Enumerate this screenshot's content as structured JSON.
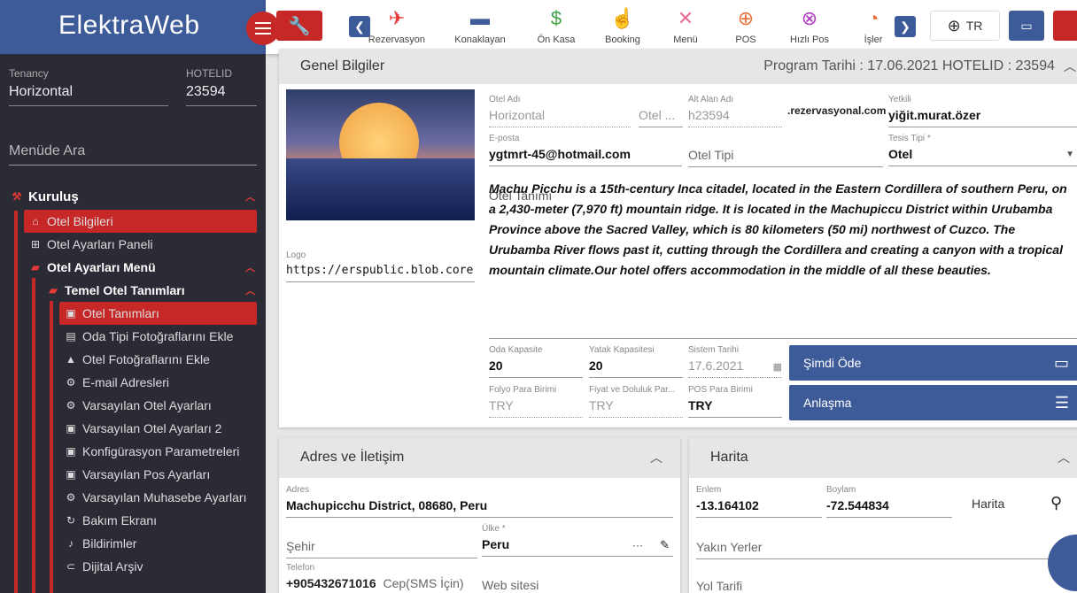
{
  "app": {
    "brand": "ElektraWeb"
  },
  "sidebar": {
    "tenancy_label": "Tenancy",
    "tenancy_value": "Horizontal",
    "hotelid_label": "HOTELID",
    "hotelid_value": "23594",
    "search_placeholder": "Menüde Ara",
    "items": [
      {
        "label": "Kuruluş",
        "icon": "gavel-icon"
      },
      {
        "label": "Otel Bilgileri",
        "icon": "bank-icon"
      },
      {
        "label": "Otel Ayarları Paneli",
        "icon": "panel-icon"
      },
      {
        "label": "Otel Ayarları Menü",
        "icon": "folder-icon"
      },
      {
        "label": "Temel Otel Tanımları",
        "icon": "folder-icon"
      },
      {
        "label": "Otel Tanımları",
        "icon": "calendar-icon"
      },
      {
        "label": "Oda Tipi Fotoğraflarını Ekle",
        "icon": "photos-icon"
      },
      {
        "label": "Otel Fotoğraflarını Ekle",
        "icon": "landscape-icon"
      },
      {
        "label": "E-mail Adresleri",
        "icon": "gear-icon"
      },
      {
        "label": "Varsayılan Otel Ayarları",
        "icon": "gear-icon"
      },
      {
        "label": "Varsayılan Otel Ayarları 2",
        "icon": "calendar-icon"
      },
      {
        "label": "Konfigürasyon Parametreleri",
        "icon": "calendar-icon"
      },
      {
        "label": "Varsayılan Pos Ayarları",
        "icon": "calendar-icon"
      },
      {
        "label": "Varsayılan Muhasebe Ayarları",
        "icon": "gear-icon"
      },
      {
        "label": "Bakım Ekranı",
        "icon": "refresh-icon"
      },
      {
        "label": "Bildirimler",
        "icon": "bell-icon"
      },
      {
        "label": "Dijital Arşiv",
        "icon": "link-icon"
      }
    ]
  },
  "toolbar": {
    "quick_links": [
      {
        "label": "Rezervasyon",
        "icon": "plane-landing-icon",
        "color": "#e53935"
      },
      {
        "label": "Konaklayan",
        "icon": "bed-icon",
        "color": "#3d5a99"
      },
      {
        "label": "Ön Kasa",
        "icon": "dollar-icon",
        "color": "#43a047"
      },
      {
        "label": "Booking",
        "icon": "hand-pointer-icon",
        "color": "#e86f9a"
      },
      {
        "label": "Menü",
        "icon": "utensils-icon",
        "color": "#e86f9a"
      },
      {
        "label": "POS",
        "icon": "cart-plus-icon",
        "color": "#e8733a"
      },
      {
        "label": "Hızlı Pos",
        "icon": "cart-icon",
        "color": "#b03ac0"
      },
      {
        "label": "İşler",
        "icon": "alarm-check-icon",
        "color": "#e8733a"
      }
    ],
    "language": "TR"
  },
  "general": {
    "title": "Genel Bilgiler",
    "program_info": "Program Tarihi : 17.06.2021 HOTELID : 23594",
    "logo_label": "Logo",
    "logo_url": "https://erspublic.blob.core.win",
    "otel_adi_label": "Otel Adı",
    "otel_adi_value": "Horizontal",
    "otel_extra_value": "Otel ...",
    "alt_alan_label": "Alt Alan Adı",
    "alt_alan_value": "h23594",
    "domain_suffix": ".rezervasyonal.com",
    "yetkili_label": "Yetkili",
    "yetkili_value": "yiğit.murat.özer",
    "eposta_label": "E-posta",
    "eposta_value": "ygtmrt-45@hotmail.com",
    "otel_tipi_placeholder": "Otel Tipi",
    "tesis_tipi_label": "Tesis Tipi *",
    "tesis_tipi_value": "Otel",
    "otel_tanimi_label": "Otel Tanımı",
    "description": "Machu Picchu is a 15th-century Inca citadel, located in the Eastern Cordillera of southern Peru, on a 2,430-meter (7,970 ft) mountain ridge. It is located in the Machupiccu District within Urubamba Province above the Sacred Valley, which is 80 kilometers (50 mi) northwest of Cuzco. The Urubamba River flows past it, cutting through the Cordillera and creating a canyon with a tropical mountain climate.Our hotel offers accommodation in the middle of all these beauties.",
    "oda_kapasite_label": "Oda Kapasite",
    "oda_kapasite_value": "20",
    "yatak_kapasitesi_label": "Yatak Kapasitesi",
    "yatak_kapasitesi_value": "20",
    "sistem_tarihi_label": "Sistem Tarihi",
    "sistem_tarihi_value": "17.6.2021",
    "folyo_label": "Folyo Para Birimi",
    "folyo_value": "TRY",
    "fiyat_label": "Fiyat ve Doluluk Par...",
    "fiyat_value": "TRY",
    "pos_label": "POS Para Birimi",
    "pos_value": "TRY",
    "simdi_ode": "Şimdi Öde",
    "anlasma": "Anlaşma"
  },
  "address": {
    "title": "Adres ve İletişim",
    "adres_label": "Adres",
    "adres_value": "Machupicchu District, 08680, Peru",
    "sehir_placeholder": "Şehir",
    "ulke_label": "Ülke *",
    "ulke_value": "Peru",
    "ulke_more": "···",
    "telefon_label": "Telefon",
    "telefon_value": "+905432671016",
    "cep_placeholder": "Cep(SMS İçin)",
    "web_placeholder": "Web sitesi"
  },
  "map": {
    "title": "Harita",
    "enlem_label": "Enlem",
    "enlem_value": "-13.164102",
    "boylam_label": "Boylam",
    "boylam_value": "-72.544834",
    "harita_label": "Harita",
    "yakin_placeholder": "Yakın Yerler",
    "yol_placeholder": "Yol Tarifi"
  }
}
